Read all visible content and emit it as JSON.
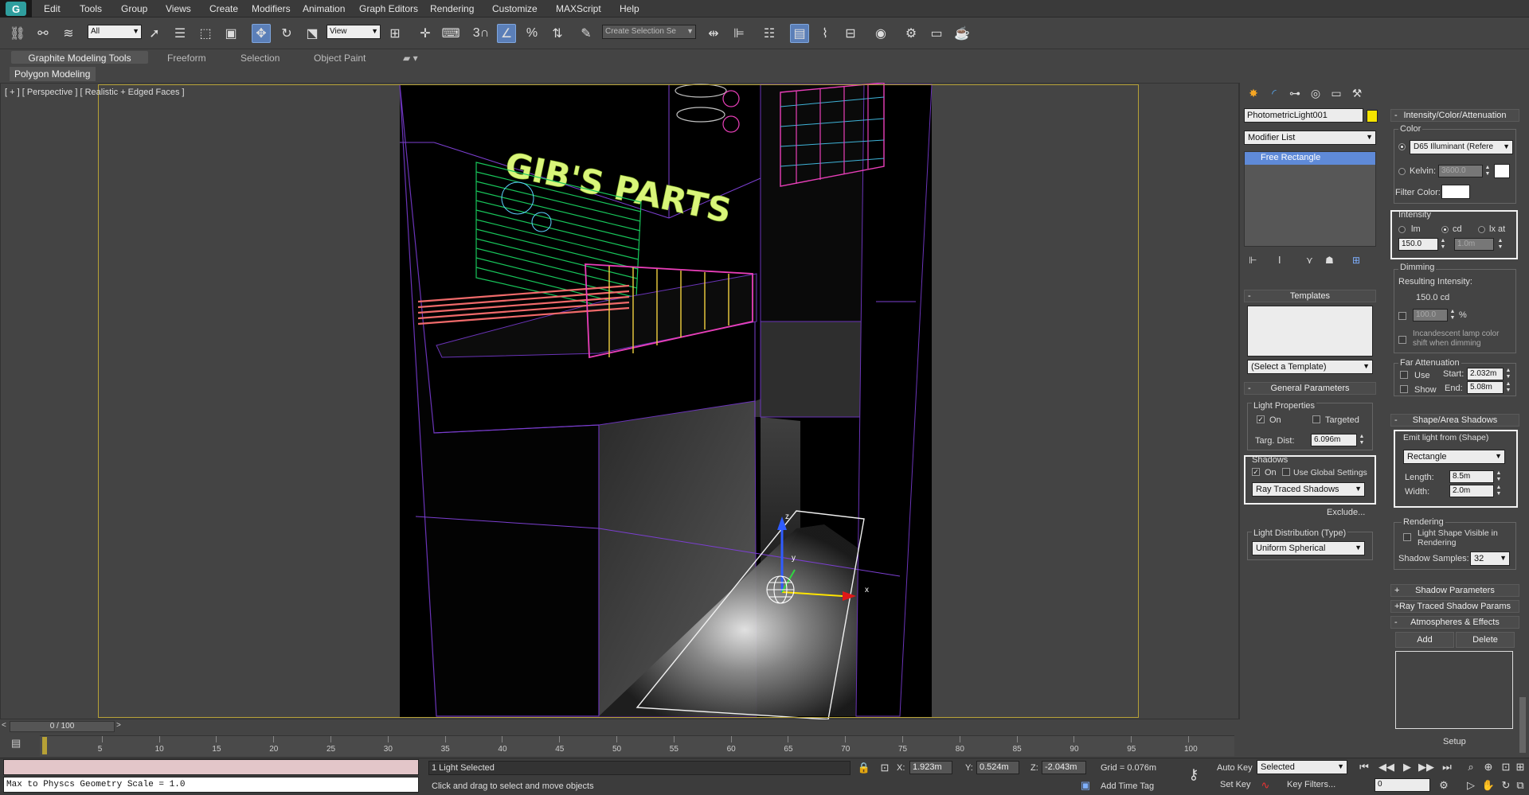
{
  "menu": [
    "Edit",
    "Tools",
    "Group",
    "Views",
    "Create",
    "Modifiers",
    "Animation",
    "Graph Editors",
    "Rendering",
    "Customize",
    "MAXScript",
    "Help"
  ],
  "toolbar": {
    "filter_value": "All",
    "ref_coord_value": "View",
    "selection_set_placeholder": "Create Selection Se",
    "snap_label": "3"
  },
  "ribbon": {
    "tabs": [
      "Graphite Modeling Tools",
      "Freeform",
      "Selection",
      "Object Paint"
    ],
    "panel_label": "Polygon Modeling"
  },
  "viewport": {
    "label": "[ + ] [ Perspective ] [ Realistic + Edged Faces ]",
    "sign_text": "GIB'S PARTS",
    "gizmo_axes": {
      "x": "x",
      "y": "y",
      "z": "z"
    }
  },
  "command_panel": {
    "object_name": "PhotometricLight001",
    "object_color": "#f5e400",
    "modifier_list_label": "Modifier List",
    "stack_item": "Free Rectangle",
    "templates": {
      "header": "Templates",
      "select": "(Select a Template)"
    },
    "general": {
      "header": "General Parameters",
      "light_properties": "Light Properties",
      "on_label": "On",
      "targeted_label": "Targeted",
      "targ_dist_label": "Targ. Dist:",
      "targ_dist_value": "6.096m",
      "shadows_label": "Shadows",
      "shadows_on_label": "On",
      "use_global_label": "Use Global Settings",
      "shadow_type": "Ray Traced Shadows",
      "exclude_label": "Exclude...",
      "distribution_label": "Light Distribution (Type)",
      "distribution_value": "Uniform Spherical"
    },
    "intensity": {
      "header": "Intensity/Color/Attenuation",
      "color_label": "Color",
      "preset_value": "D65 Illuminant (Refere",
      "kelvin_label": "Kelvin:",
      "kelvin_value": "3600.0",
      "filter_color_label": "Filter Color:",
      "intensity_label": "Intensity",
      "unit_lm": "lm",
      "unit_cd": "cd",
      "unit_lx": "lx at",
      "intensity_value": "150.0",
      "lx_distance": "1.0m",
      "dimming_label": "Dimming",
      "resulting_label": "Resulting Intensity:",
      "resulting_value": "150.0 cd",
      "dimming_value": "100.0",
      "percent": "%",
      "incandescent_label": "Incandescent lamp color shift when dimming",
      "far_attenuation_label": "Far Attenuation",
      "use_label": "Use",
      "show_label": "Show",
      "start_label": "Start:",
      "start_value": "2.032m",
      "end_label": "End:",
      "end_value": "5.08m"
    },
    "shape": {
      "header": "Shape/Area Shadows",
      "emit_label": "Emit light from (Shape)",
      "shape_value": "Rectangle",
      "length_label": "Length:",
      "length_value": "8.5m",
      "width_label": "Width:",
      "width_value": "2.0m",
      "rendering_label": "Rendering",
      "visible_label": "Light Shape Visible in Rendering",
      "samples_label": "Shadow Samples:",
      "samples_value": "32"
    },
    "collapsed": [
      "Shadow Parameters",
      "Ray Traced Shadow Params"
    ],
    "atmos": {
      "header": "Atmospheres & Effects",
      "add": "Add",
      "delete": "Delete",
      "setup": "Setup"
    }
  },
  "timeline": {
    "slider_label": "0 / 100",
    "ticks": [
      "5",
      "10",
      "15",
      "20",
      "25",
      "30",
      "35",
      "40",
      "45",
      "50",
      "55",
      "60",
      "65",
      "70",
      "75",
      "80",
      "85",
      "90",
      "95",
      "100"
    ]
  },
  "status": {
    "script_output": "Max to Physcs Geometry Scale = 1.0",
    "selected_count": "1 Light Selected",
    "prompt": "Click and drag to select and move objects",
    "x_label": "X:",
    "x_value": "1.923m",
    "y_label": "Y:",
    "y_value": "0.524m",
    "z_label": "Z:",
    "z_value": "-2.043m",
    "grid": "Grid = 0.076m",
    "add_time_tag": "Add Time Tag",
    "auto_key": "Auto Key",
    "set_key": "Set Key",
    "selected_dropdown": "Selected",
    "key_filters": "Key Filters...",
    "frame_value": "0"
  }
}
